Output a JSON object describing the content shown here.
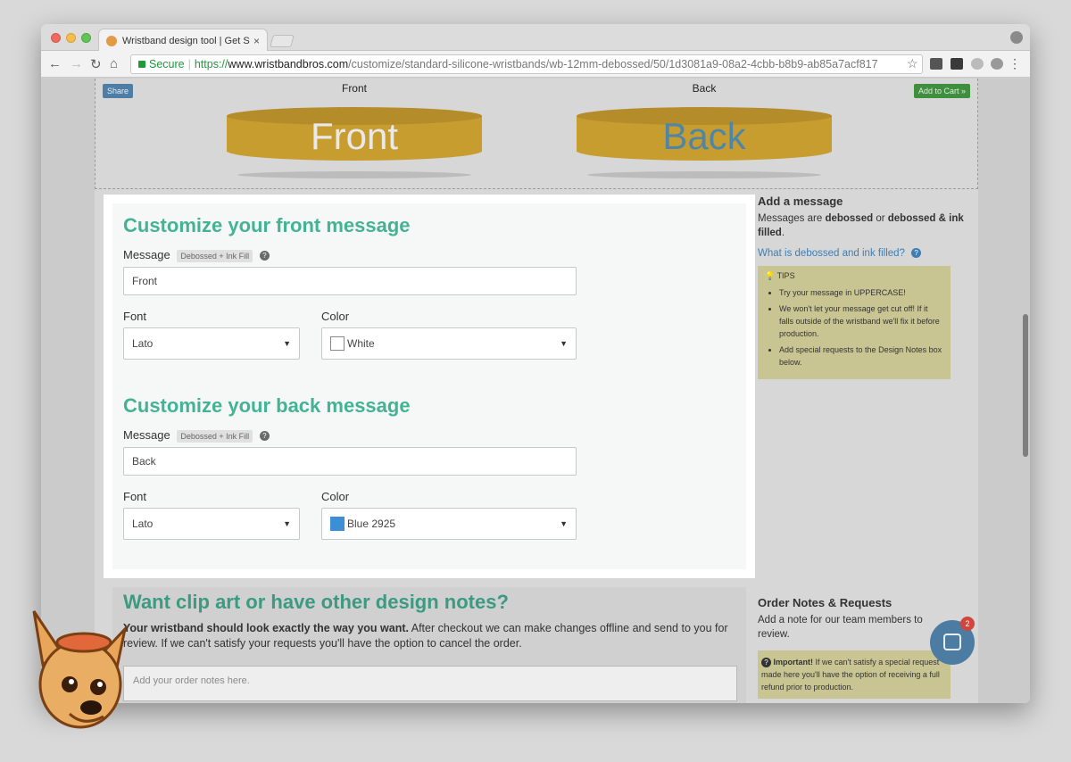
{
  "browser": {
    "tab_title": "Wristband design tool | Get St",
    "tab_close": "×",
    "url_secure_label": "Secure",
    "url_scheme": "https://",
    "url_host": "www.wristbandbros.com",
    "url_path": "/customize/standard-silicone-wristbands/wb-12mm-debossed/50/1d3081a9-08a2-4cbb-b8b9-ab85a7acf817"
  },
  "preview": {
    "share_label": "Share",
    "cart_label": "Add to Cart »",
    "front_label": "Front",
    "back_label": "Back",
    "front_text": "Front",
    "back_text": "Back",
    "band_color": "#c89d2f",
    "front_text_color": "#e9e9e9",
    "back_text_color": "#4f86a8"
  },
  "front": {
    "title": "Customize your front message",
    "message_label": "Message",
    "badge": "Debossed + Ink Fill",
    "message_value": "Front",
    "font_label": "Font",
    "font_value": "Lato",
    "color_label": "Color",
    "color_value": "White",
    "swatch": "#ffffff"
  },
  "back": {
    "title": "Customize your back message",
    "message_label": "Message",
    "badge": "Debossed + Ink Fill",
    "message_value": "Back",
    "font_label": "Font",
    "font_value": "Lato",
    "color_label": "Color",
    "color_value": "Blue 2925",
    "swatch": "#3a8fd6"
  },
  "sidebar": {
    "heading": "Add a message",
    "text_a": "Messages are ",
    "text_b": "debossed",
    "text_c": " or ",
    "text_d": "debossed & ink filled",
    "text_e": ".",
    "link": "What is debossed and ink filled?",
    "tips_title": "TIPS",
    "tips": [
      "Try your message in UPPERCASE!",
      "We won't let your message get cut off! If it falls outside of the wristband we'll fix it before production.",
      "Add special requests to the Design Notes box below."
    ]
  },
  "notes": {
    "title": "Want clip art or have other design notes?",
    "text_bold": "Your wristband should look exactly the way you want.",
    "text_rest": " After checkout we can make changes offline and send to you for review. If we can't satisfy your requests you'll have the option to cancel the order.",
    "placeholder": "Add your order notes here.",
    "side_heading": "Order Notes & Requests",
    "side_text": "Add a note for our team members to review.",
    "important_label": "Important!",
    "important_text": " If we can't satisfy a special request made here you'll have the option of receiving a full refund prior to production."
  },
  "chat": {
    "badge_count": "2"
  },
  "colors": {
    "accent": "#44b394",
    "link": "#3d7fb5",
    "tips_bg": "#c9c593"
  }
}
